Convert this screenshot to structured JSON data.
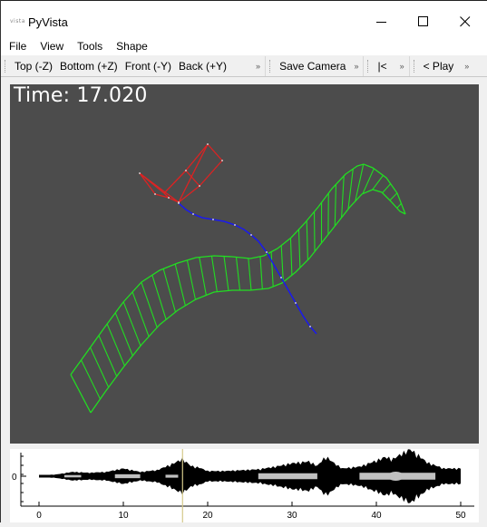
{
  "window": {
    "title": "PyVista",
    "logo_text": "vista",
    "controls": [
      "minimize",
      "maximize",
      "close"
    ]
  },
  "menubar": {
    "items": [
      "File",
      "View",
      "Tools",
      "Shape"
    ]
  },
  "toolbar": {
    "camera_views": [
      "Top (-Z)",
      "Bottom (+Z)",
      "Front (-Y)",
      "Back (+Y)"
    ],
    "save_camera": "Save Camera",
    "rewind": "|<",
    "play": "< Play",
    "extension_glyph": "»"
  },
  "viewport": {
    "time_label": "Time: 17.020",
    "background_color": "#4c4c4c",
    "objects": [
      {
        "name": "wing-surface",
        "color": "#22dd22",
        "style": "wireframe ribbon"
      },
      {
        "name": "trajectory",
        "color": "#1a1aee",
        "style": "polyline with points"
      },
      {
        "name": "body-frame",
        "color": "#dd2222",
        "style": "wireframe box and fin"
      }
    ]
  },
  "signal_plot": {
    "y_tick_label": "0",
    "x_tick_labels": [
      "0",
      "10",
      "20",
      "30",
      "40",
      "50"
    ],
    "x_range": [
      0,
      50
    ],
    "cursor_time": 17.02,
    "cursor_color": "#d4c98a",
    "fill_color": "#000000",
    "inner_fill_color": "#c0c0c0"
  },
  "chart_data": {
    "type": "area",
    "title": "",
    "xlabel": "",
    "ylabel": "",
    "x_ticks": [
      0,
      10,
      20,
      30,
      40,
      50
    ],
    "y_ticks": [
      0
    ],
    "xlim": [
      -3,
      52.5
    ],
    "envelope": {
      "x": [
        0,
        2,
        4,
        6,
        8,
        10,
        12,
        14,
        15,
        16,
        17,
        18,
        19,
        20,
        22,
        24,
        26,
        28,
        30,
        32,
        33,
        34,
        35,
        36,
        38,
        40,
        41,
        42,
        43,
        44,
        45,
        46,
        48,
        50
      ],
      "amplitude": [
        0.05,
        0.1,
        0.25,
        0.2,
        0.25,
        0.45,
        0.25,
        0.35,
        0.55,
        0.75,
        1.0,
        0.6,
        0.5,
        0.3,
        0.3,
        0.35,
        0.4,
        0.55,
        0.75,
        0.85,
        0.6,
        1.15,
        0.75,
        0.45,
        0.55,
        0.9,
        1.1,
        1.0,
        1.3,
        1.55,
        1.2,
        0.8,
        0.45,
        0.45
      ]
    },
    "cursor_x": 17.02
  }
}
